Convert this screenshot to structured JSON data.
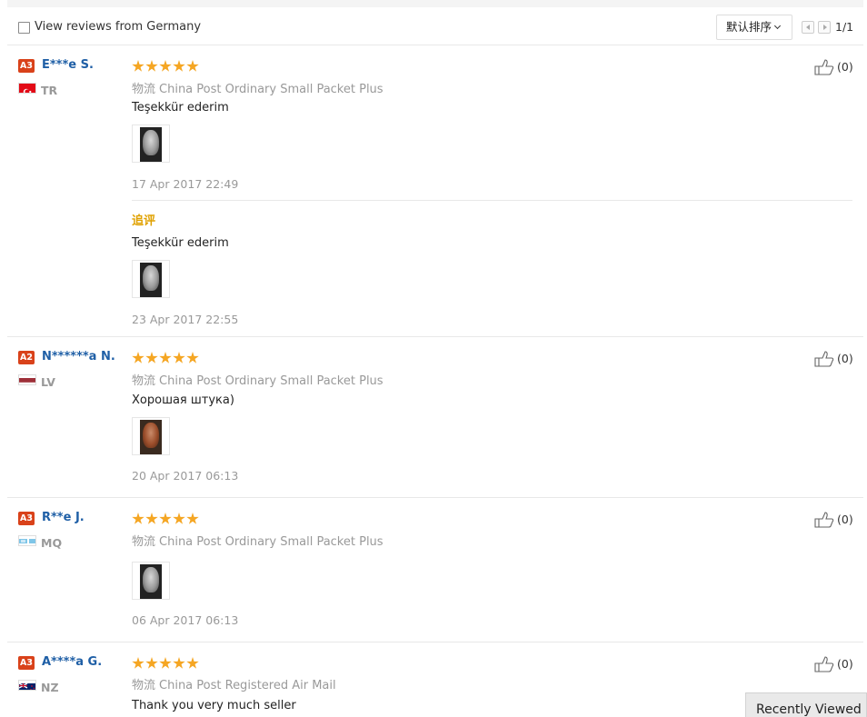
{
  "toolbar": {
    "filter_label": "View reviews from Germany",
    "sort_label": "默认排序",
    "page_indicator": "1/1"
  },
  "shipping_prefix": "物流",
  "reviews": [
    {
      "badge": "A3",
      "name": "E***e S.",
      "country": "TR",
      "flag": "tr",
      "rating": 5,
      "shipping": "China Post Ordinary Small Packet Plus",
      "text": "Teşekkür ederim",
      "date": "17 Apr 2017 22:49",
      "likes": "(0)",
      "followup": {
        "label": "追评",
        "text": "Teşekkür ederim",
        "date": "23 Apr 2017 22:55"
      }
    },
    {
      "badge": "A2",
      "name": "N******a N.",
      "country": "LV",
      "flag": "lv",
      "rating": 5,
      "shipping": "China Post Ordinary Small Packet Plus",
      "text": "Хорошая штука)",
      "date": "20 Apr 2017 06:13",
      "likes": "(0)"
    },
    {
      "badge": "A3",
      "name": "R**e J.",
      "country": "MQ",
      "flag": "mq",
      "rating": 5,
      "shipping": "China Post Ordinary Small Packet Plus",
      "text": "",
      "date": "06 Apr 2017 06:13",
      "likes": "(0)"
    },
    {
      "badge": "A3",
      "name": "A****a G.",
      "country": "NZ",
      "flag": "nz",
      "rating": 5,
      "shipping": "China Post Registered Air Mail",
      "text": "Thank you very much seller",
      "likes": "(0)"
    }
  ],
  "recently_viewed": "Recently Viewed",
  "colors": {
    "accent_orange": "#f5a623",
    "username_blue": "#1f5fa6",
    "badge_red": "#d9421a",
    "followup_gold": "#e0a100"
  }
}
